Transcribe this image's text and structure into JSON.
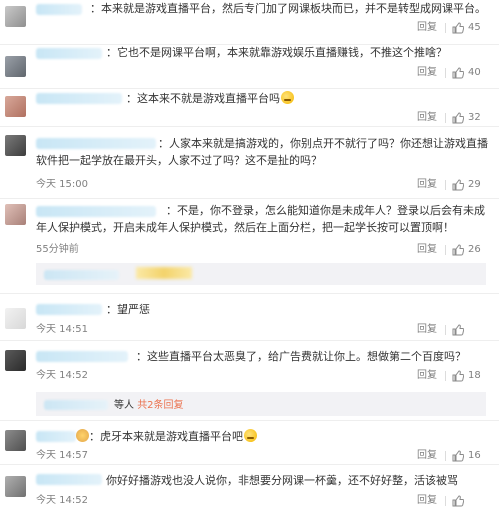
{
  "ui": {
    "reply_label": "回复"
  },
  "comments": [
    {
      "text": "本来就是游戏直播平台，然后专门加了网课板块而已，并不是转型成网课平台。",
      "likes": "45"
    },
    {
      "text": "它也不是网课平台啊，本来就靠游戏娱乐直播赚钱，不推这个推啥？",
      "likes": "40"
    },
    {
      "text": "这本来不就是游戏直播平台吗",
      "likes": "32"
    },
    {
      "text": "人家本来就是搞游戏的，你别点开不就行了吗？你还想让游戏直播软件把一起学放在最开头，人家不过了吗？这不是扯的吗？",
      "time": "今天 15:00",
      "likes": "29"
    },
    {
      "text": "不是，你不登录，怎么能知道你是未成年人？登录以后会有未成年人保护模式，开启未成年人保护模式，然后在上面分栏，把一起学长按可以置顶啊！",
      "time": "55分钟前",
      "likes": "26"
    },
    {
      "text": "望严惩",
      "time": "今天 14:51",
      "likes": ""
    },
    {
      "text": "这些直播平台太恶臭了，给广告费就让你上。想做第二个百度吗？",
      "time": "今天 14:52",
      "likes": "18"
    },
    {
      "text": "虎牙本来就是游戏直播平台吧",
      "time": "今天 14:57",
      "likes": "16"
    },
    {
      "text": "你好好播游戏也没人说你，非想要分网课一杯羹，还不好好整，活该被骂",
      "time": "今天 14:52",
      "likes": ""
    }
  ],
  "subreply": {
    "prefix": "等人",
    "link": "共2条回复"
  }
}
